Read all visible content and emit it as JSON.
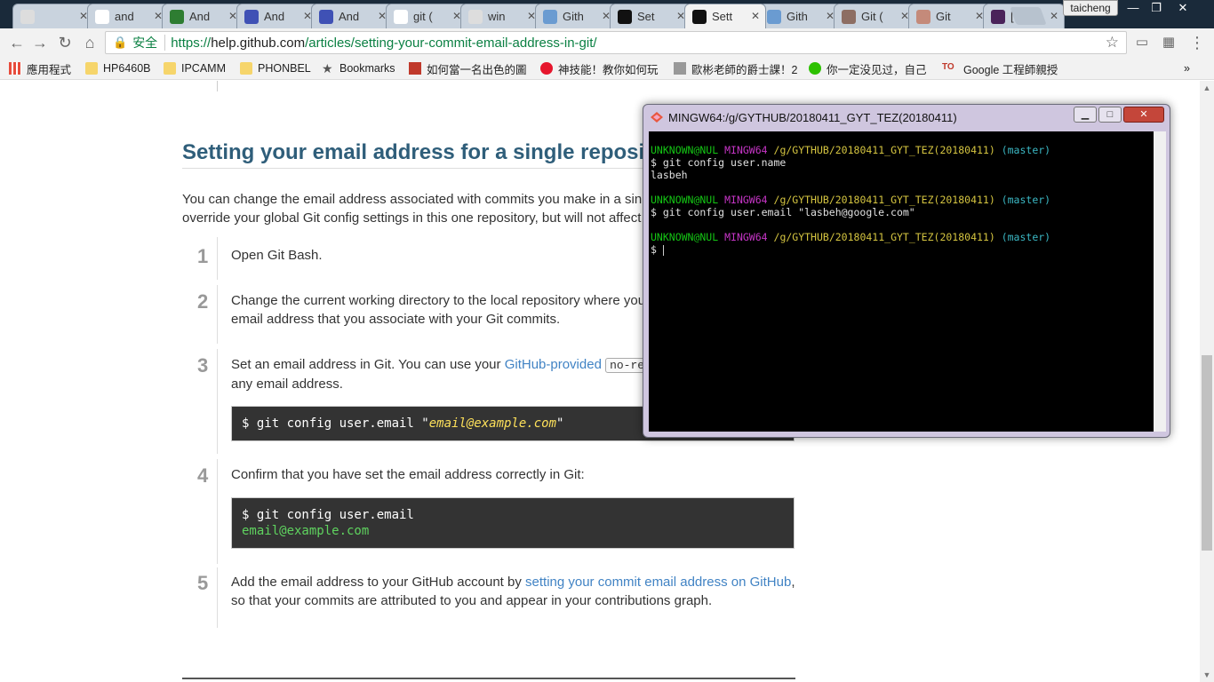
{
  "tabs": [
    {
      "title": "",
      "icon": "page-icon",
      "color": "#dddddd"
    },
    {
      "title": "and",
      "icon": "google-icon",
      "color": "#ffffff"
    },
    {
      "title": "And",
      "icon": "dot-icon",
      "color": "#2e7d32"
    },
    {
      "title": "And",
      "icon": "blue-page-icon",
      "color": "#3f51b5"
    },
    {
      "title": "And",
      "icon": "blue-page-icon",
      "color": "#3f51b5"
    },
    {
      "title": "git (",
      "icon": "google-icon",
      "color": "#ffffff"
    },
    {
      "title": "win",
      "icon": "page-icon",
      "color": "#dddddd"
    },
    {
      "title": "Gith",
      "icon": "globe-icon",
      "color": "#6a9bd1"
    },
    {
      "title": "Set",
      "icon": "github-icon",
      "color": "#111111"
    },
    {
      "title": "Sett",
      "icon": "github-icon",
      "color": "#111111",
      "active": true
    },
    {
      "title": "Gith",
      "icon": "globe-icon",
      "color": "#6a9bd1"
    },
    {
      "title": "Git (",
      "icon": "avatar-icon",
      "color": "#8d6e63"
    },
    {
      "title": "Git",
      "icon": "avatar-icon",
      "color": "#c48a7a"
    },
    {
      "title": "[Git",
      "icon": "dark-square-icon",
      "color": "#4a235a"
    }
  ],
  "profile": "taicheng",
  "address": {
    "secure_label": "安全",
    "url_scheme": "https://",
    "url_host": "help.github.com",
    "url_path": "/articles/setting-your-commit-email-address-in-git/"
  },
  "bookmarks": [
    {
      "label": "應用程式",
      "icon": "apps-icon"
    },
    {
      "label": "HP6460B",
      "icon": "folder-icon"
    },
    {
      "label": "IPCAMM",
      "icon": "folder-icon"
    },
    {
      "label": "PHONBEL",
      "icon": "folder-icon"
    },
    {
      "label": "Bookmarks",
      "icon": "star-icon"
    },
    {
      "label": "如何當一名出色的圖",
      "icon": "linkedin-icon"
    },
    {
      "label": "神技能！教你如何玩",
      "icon": "weibo-icon"
    },
    {
      "label": "歐彬老師的爵士課！2",
      "icon": "logo-icon"
    },
    {
      "label": "你一定没见过，自己",
      "icon": "wechat-icon"
    },
    {
      "label": "Google 工程師親授",
      "icon": "to-icon"
    }
  ],
  "article": {
    "heading": "Setting your email address for a single reposi",
    "intro_1": "You can change the email address associated with commits you make in a sin",
    "intro_2": "override your global Git config settings in this one repository, but will not affect",
    "steps": [
      {
        "num": "1",
        "text": "Open Git Bash."
      },
      {
        "num": "2",
        "text_1": "Change the current working directory to the local repository where you",
        "text_2": "email address that you associate with your Git commits."
      },
      {
        "num": "3",
        "text_a": "Set an email address in Git. You can use your ",
        "link": "GitHub-provided",
        "code": "no-re",
        "text_b": "any email address.",
        "cmd_prefix": "$ git config user.email \"",
        "cmd_em": "email@example.com",
        "cmd_suffix": "\""
      },
      {
        "num": "4",
        "text": "Confirm that you have set the email address correctly in Git:",
        "cmd": "$ git config user.email",
        "output": "email@example.com"
      },
      {
        "num": "5",
        "text_a": "Add the email address to your GitHub account by ",
        "link": "setting your commit email address on GitHub",
        "text_b": ",",
        "text_c": "so that your commits are attributed to you and appear in your contributions graph."
      }
    ]
  },
  "terminal": {
    "title": "MINGW64:/g/GYTHUB/20180411_GYT_TEZ(20180411)",
    "prompt_user": "UNKNOWN@NUL",
    "prompt_env": "MINGW64",
    "prompt_path": "/g/GYTHUB/20180411_GYT_TEZ(20180411)",
    "prompt_branch": "(master)",
    "cmd1": "$ git config user.name",
    "out1": "lasbeh",
    "cmd2": "$ git config user.email \"lasbeh@google.com\"",
    "cmd3": "$ "
  }
}
